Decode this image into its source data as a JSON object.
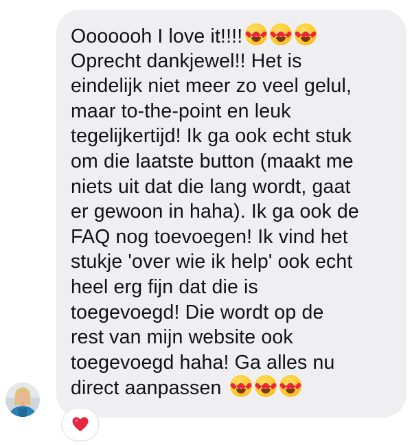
{
  "message": {
    "lines": [
      "Ooooooh I love it!!!!",
      "Oprecht dankjewel!! Het is",
      "eindelijk niet meer zo veel gelul,",
      "maar to-the-point en leuk",
      "tegelijkertijd! Ik ga ook echt stuk",
      "om die laatste button (maakt me",
      "niets uit dat die lang wordt, gaat",
      "er gewoon in haha). Ik ga ook de",
      "FAQ nog toevoegen! Ik vind het",
      "stukje 'over wie ik help' ook echt",
      "heel erg fijn dat die is",
      "toegevoegd! Die wordt op de",
      "rest van mijn website ook",
      "toegevoegd haha! Ga alles nu",
      "direct aanpassen"
    ],
    "emoji_name": "heart-eyes-emoji",
    "emoji_count_first_line": 3,
    "emoji_count_last_line": 3,
    "bubble_color": "#efeff1",
    "text_color": "#111111"
  },
  "sender": {
    "avatar_icon": "profile-photo"
  },
  "reaction": {
    "icon": "red-heart-icon",
    "color": "#e8233f"
  }
}
